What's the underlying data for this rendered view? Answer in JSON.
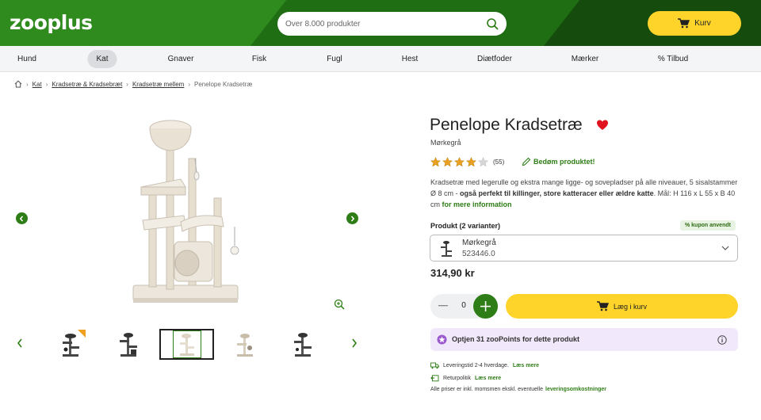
{
  "header": {
    "logo": "zooplus",
    "search_placeholder": "Over 8.000 produkter",
    "cart_label": "Kurv"
  },
  "nav": {
    "items": [
      "Hund",
      "Kat",
      "Gnaver",
      "Fisk",
      "Fugl",
      "Hest",
      "Diætfoder",
      "Mærker",
      "% Tilbud"
    ],
    "active": "Kat"
  },
  "breadcrumb": {
    "items": [
      "Kat",
      "Kradsetræ & Kradsebræt",
      "Kradsetræ mellem"
    ],
    "current": "Penelope Kradsetræ"
  },
  "product": {
    "title": "Penelope Kradsetræ",
    "subtitle": "Mørkegrå",
    "rating": 4,
    "rating_max": 5,
    "review_count": "(55)",
    "rate_link": "Bedøm produktet!",
    "description_plain": "Kradsetræ med legerulle og ekstra mange ligge- og sovepladser på alle niveauer, 5 sisalstammer Ø 8 cm - ",
    "description_bold": "også perfekt til killinger, store katteracer eller ældre katte",
    "description_end": ". Mål: H 116 x L 55 x B 40 cm ",
    "more_info": "for mere information",
    "variant_label": "Produkt (2 varianter)",
    "coupon_badge": "% kupon anvendt",
    "variant_name": "Mørkegrå",
    "variant_number": "523446.0",
    "price": "314,90 kr",
    "quantity": "0",
    "add_to_cart": "Læg i kurv",
    "points_text": "Optjen 31 zooPoints for dette produkt"
  },
  "delivery": {
    "shipping_text": "Leveringstid 2-4 hverdage.",
    "shipping_link": "Læs mere",
    "return_text": "Returpolitik",
    "return_link": "Læs mere",
    "prices_text": "Alle priser er inkl. momsmen ekskl. eventuelle",
    "prices_link": "leveringsomkostninger"
  },
  "colors": {
    "brand_green": "#2e7d16",
    "cart_yellow": "#ffd42a",
    "heart_red": "#e0141e",
    "star_orange": "#e8a020",
    "points_purple": "#9b59d0"
  },
  "icons": [
    "search-icon",
    "cart-icon",
    "home-icon",
    "heart-icon",
    "star-icon",
    "pencil-icon",
    "zoom-icon",
    "chevron-left-icon",
    "chevron-right-icon",
    "chevron-down-icon",
    "plus-icon",
    "minus-icon",
    "info-icon",
    "truck-icon",
    "return-icon",
    "zoopoints-icon"
  ]
}
